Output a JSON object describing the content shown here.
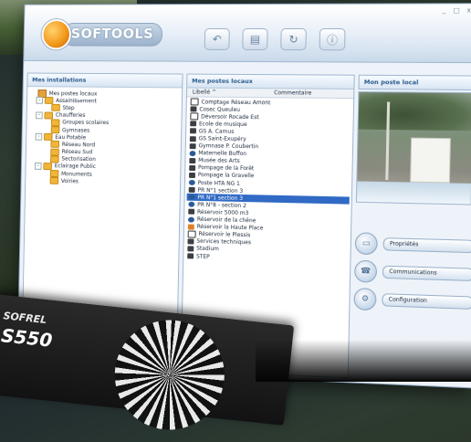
{
  "window": {
    "controls": [
      "_",
      "□",
      "x"
    ]
  },
  "logo": {
    "text": "SOFTOOLS"
  },
  "toolbar": {
    "icons": [
      "back-arrow-icon",
      "document-icon",
      "refresh-icon",
      "info-icon"
    ]
  },
  "installations": {
    "title": "Mes installations",
    "tree": [
      {
        "label": "Mes postes locaux",
        "level": 0,
        "type": "root",
        "expander": ""
      },
      {
        "label": "Assainissement",
        "level": 1,
        "type": "folder",
        "expander": "-"
      },
      {
        "label": "Step",
        "level": 2,
        "type": "folder",
        "expander": ""
      },
      {
        "label": "Chaufferies",
        "level": 1,
        "type": "folder",
        "expander": "-"
      },
      {
        "label": "Groupes scolaires",
        "level": 2,
        "type": "folder",
        "expander": ""
      },
      {
        "label": "Gymnases",
        "level": 2,
        "type": "folder",
        "expander": ""
      },
      {
        "label": "Eau Potable",
        "level": 1,
        "type": "folder",
        "expander": "-"
      },
      {
        "label": "Réseau Nord",
        "level": 2,
        "type": "folder",
        "expander": ""
      },
      {
        "label": "Réseau Sud",
        "level": 2,
        "type": "folder",
        "expander": ""
      },
      {
        "label": "Sectorisation",
        "level": 2,
        "type": "folder",
        "expander": ""
      },
      {
        "label": "Eclairage Public",
        "level": 1,
        "type": "folder",
        "expander": "-"
      },
      {
        "label": "Monuments",
        "level": 2,
        "type": "folder",
        "expander": ""
      },
      {
        "label": "Voiries",
        "level": 2,
        "type": "folder",
        "expander": ""
      }
    ]
  },
  "postes": {
    "title": "Mes postes locaux",
    "columns": {
      "libelle": "Libellé  ^",
      "commentaire": "Commentaire"
    },
    "rows": [
      {
        "label": "Comptage Réseau Amont",
        "icon": "box",
        "selected": false
      },
      {
        "label": "Cosec Queuleu",
        "icon": "dark",
        "selected": false
      },
      {
        "label": "Déversoir Rocade Est",
        "icon": "box",
        "selected": false
      },
      {
        "label": "Ecole de musique",
        "icon": "dark",
        "selected": false
      },
      {
        "label": "GS A. Camus",
        "icon": "dark",
        "selected": false
      },
      {
        "label": "GS Saint-Exupéry",
        "icon": "dark",
        "selected": false
      },
      {
        "label": "Gymnase P. Coubertin",
        "icon": "dark",
        "selected": false
      },
      {
        "label": "Maternelle Buffon",
        "icon": "blue",
        "selected": false
      },
      {
        "label": "Musée des Arts",
        "icon": "dark",
        "selected": false
      },
      {
        "label": "Pompage de la Forêt",
        "icon": "dark",
        "selected": false
      },
      {
        "label": "Pompage la Gravelle",
        "icon": "dark",
        "selected": false
      },
      {
        "label": "Poste HTA NG 1",
        "icon": "blue",
        "selected": false
      },
      {
        "label": "PR N°1 section 3",
        "icon": "dark",
        "selected": false
      },
      {
        "label": "PR N°1 section 3",
        "icon": "blue",
        "selected": true
      },
      {
        "label": "PR N°8 - section 2",
        "icon": "blue",
        "selected": false
      },
      {
        "label": "Réservoir 5000 m3",
        "icon": "dark",
        "selected": false
      },
      {
        "label": "Réservoir de la chêne",
        "icon": "blue",
        "selected": false
      },
      {
        "label": "Réservoir la Haute Place",
        "icon": "orange",
        "selected": false
      },
      {
        "label": "Réservoir le Plessis",
        "icon": "box",
        "selected": false
      },
      {
        "label": "Services techniques",
        "icon": "dark",
        "selected": false
      },
      {
        "label": "Stadium",
        "icon": "dark",
        "selected": false
      },
      {
        "label": "STEP",
        "icon": "dark",
        "selected": false
      }
    ]
  },
  "poste_local": {
    "title": "Mon poste local",
    "actions": [
      {
        "label": "Propriétés",
        "icon": "properties-icon",
        "glyph": "▭"
      },
      {
        "label": "Communications",
        "icon": "communications-icon",
        "glyph": "☎"
      },
      {
        "label": "Configuration",
        "icon": "configuration-icon",
        "glyph": "⚙"
      }
    ]
  },
  "device": {
    "brand": "SOFREL",
    "model": "S550"
  },
  "colors": {
    "accent": "#316ac5",
    "title_text": "#2a5a8c",
    "logo_orange": "#f39a1c"
  }
}
